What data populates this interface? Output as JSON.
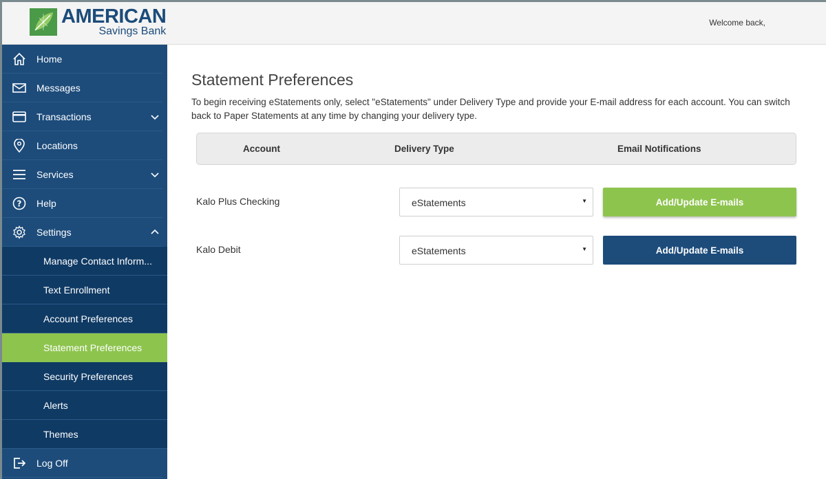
{
  "header": {
    "logo_title": "AMERICAN",
    "logo_subtitle": "Savings Bank",
    "welcome": "Welcome back,"
  },
  "sidebar": {
    "items": [
      {
        "label": "Home",
        "icon": "home-icon"
      },
      {
        "label": "Messages",
        "icon": "envelope-icon"
      },
      {
        "label": "Transactions",
        "icon": "card-icon"
      },
      {
        "label": "Locations",
        "icon": "map-pin-icon"
      },
      {
        "label": "Services",
        "icon": "menu-icon"
      },
      {
        "label": "Help",
        "icon": "help-icon"
      },
      {
        "label": "Settings",
        "icon": "gear-icon"
      }
    ],
    "settings_sub": [
      "Manage Contact Inform...",
      "Text Enrollment",
      "Account Preferences",
      "Statement Preferences",
      "Security Preferences",
      "Alerts",
      "Themes"
    ],
    "logoff": {
      "label": "Log Off",
      "icon": "logout-icon"
    }
  },
  "main": {
    "title": "Statement Preferences",
    "intro": "To begin receiving eStatements only, select \"eStatements\" under Delivery Type and provide your E-mail address for each account. You can switch back to Paper Statements at any time by changing your delivery type.",
    "columns": [
      "Account",
      "Delivery Type",
      "Email Notifications"
    ],
    "rows": [
      {
        "account": "Kalo Plus Checking",
        "delivery": "eStatements",
        "button": "Add/Update E-mails"
      },
      {
        "account": "Kalo Debit",
        "delivery": "eStatements",
        "button": "Add/Update E-mails"
      }
    ]
  },
  "colors": {
    "brand_blue": "#1d4c7b",
    "accent_green": "#8dc44e"
  }
}
